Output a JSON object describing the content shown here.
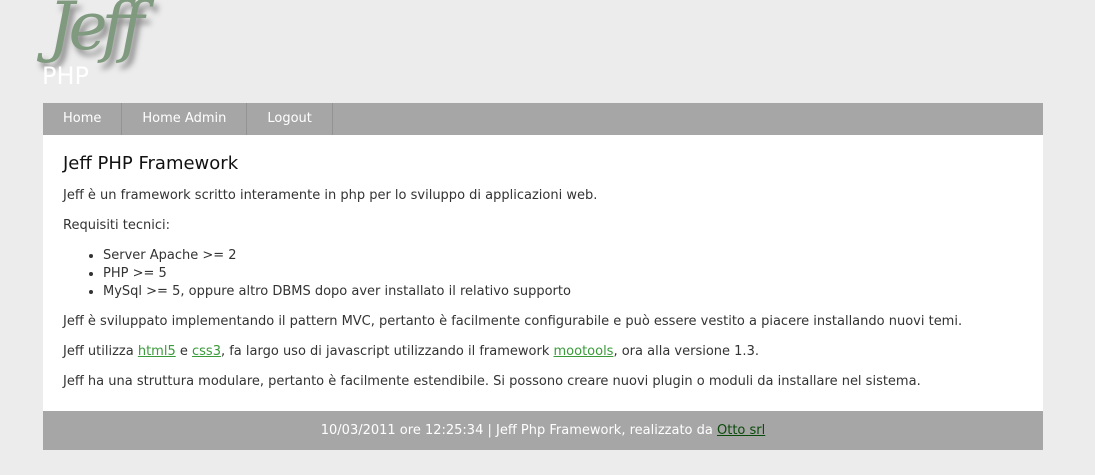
{
  "logo": {
    "script_text": "Jeff",
    "sub_text": "PHP"
  },
  "nav": {
    "items": [
      {
        "label": "Home"
      },
      {
        "label": "Home Admin"
      },
      {
        "label": "Logout"
      }
    ]
  },
  "main": {
    "title": "Jeff PHP Framework",
    "intro": "Jeff è un framework scritto interamente in php per lo sviluppo di applicazioni web.",
    "requirements_heading": "Requisiti tecnici:",
    "requirements": [
      "Server Apache >= 2",
      "PHP >= 5",
      "MySql >= 5, oppure altro DBMS dopo aver installato il relativo supporto"
    ],
    "mvc_text": "Jeff è sviluppato implementando il pattern MVC, pertanto è facilmente configurabile e può essere vestito a piacere installando nuovi temi.",
    "uses": {
      "prefix": "Jeff utilizza ",
      "html5_link": "html5",
      "and": " e ",
      "css3_link": "css3",
      "middle": ", fa largo uso di javascript utilizzando il framework ",
      "mootools_link": "mootools",
      "suffix": ", ora alla versione 1.3."
    },
    "modular_text": "Jeff ha una struttura modulare, pertanto è facilmente estendibile. Si possono creare nuovi plugin o moduli da installare nel sistema."
  },
  "footer": {
    "text": "10/03/2011 ore 12:25:34 | Jeff Php Framework, realizzato da ",
    "link": "Otto srl"
  },
  "colors": {
    "background": "#ececec",
    "bar": "#a6a6a6",
    "link": "#3a9a3a",
    "footer_link": "#0a4a0a",
    "logo_green": "#7f9a7f"
  }
}
